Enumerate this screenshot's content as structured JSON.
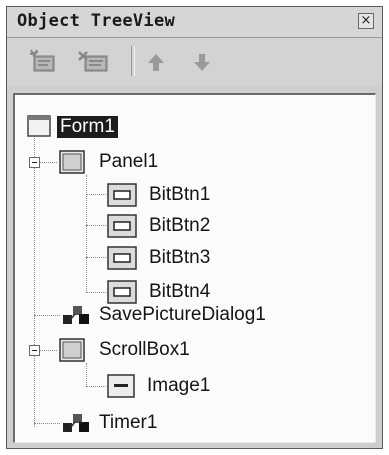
{
  "window": {
    "title": "Object TreeView",
    "close_label": "×"
  },
  "toolbar": {
    "buttons": [
      {
        "name": "add-item-button",
        "icon": "tree-add-icon"
      },
      {
        "name": "remove-item-button",
        "icon": "tree-remove-icon"
      },
      {
        "name": "move-up-button",
        "icon": "arrow-up-icon"
      },
      {
        "name": "move-down-button",
        "icon": "arrow-down-icon"
      }
    ]
  },
  "tree": {
    "nodes": [
      {
        "label": "Form1",
        "icon": "form-icon",
        "level": 0,
        "selected": true
      },
      {
        "label": "Panel1",
        "icon": "panel-icon",
        "level": 1,
        "expanded": true
      },
      {
        "label": "BitBtn1",
        "icon": "button-icon",
        "level": 2
      },
      {
        "label": "BitBtn2",
        "icon": "button-icon",
        "level": 2
      },
      {
        "label": "BitBtn3",
        "icon": "button-icon",
        "level": 2
      },
      {
        "label": "BitBtn4",
        "icon": "button-icon",
        "level": 2
      },
      {
        "label": "SavePictureDialog1",
        "icon": "nonvisual-component-icon",
        "level": 1
      },
      {
        "label": "ScrollBox1",
        "icon": "panel-icon",
        "level": 1,
        "expanded": true
      },
      {
        "label": "Image1",
        "icon": "image-icon",
        "level": 2
      },
      {
        "label": "Timer1",
        "icon": "nonvisual-component-icon",
        "level": 1
      }
    ]
  }
}
